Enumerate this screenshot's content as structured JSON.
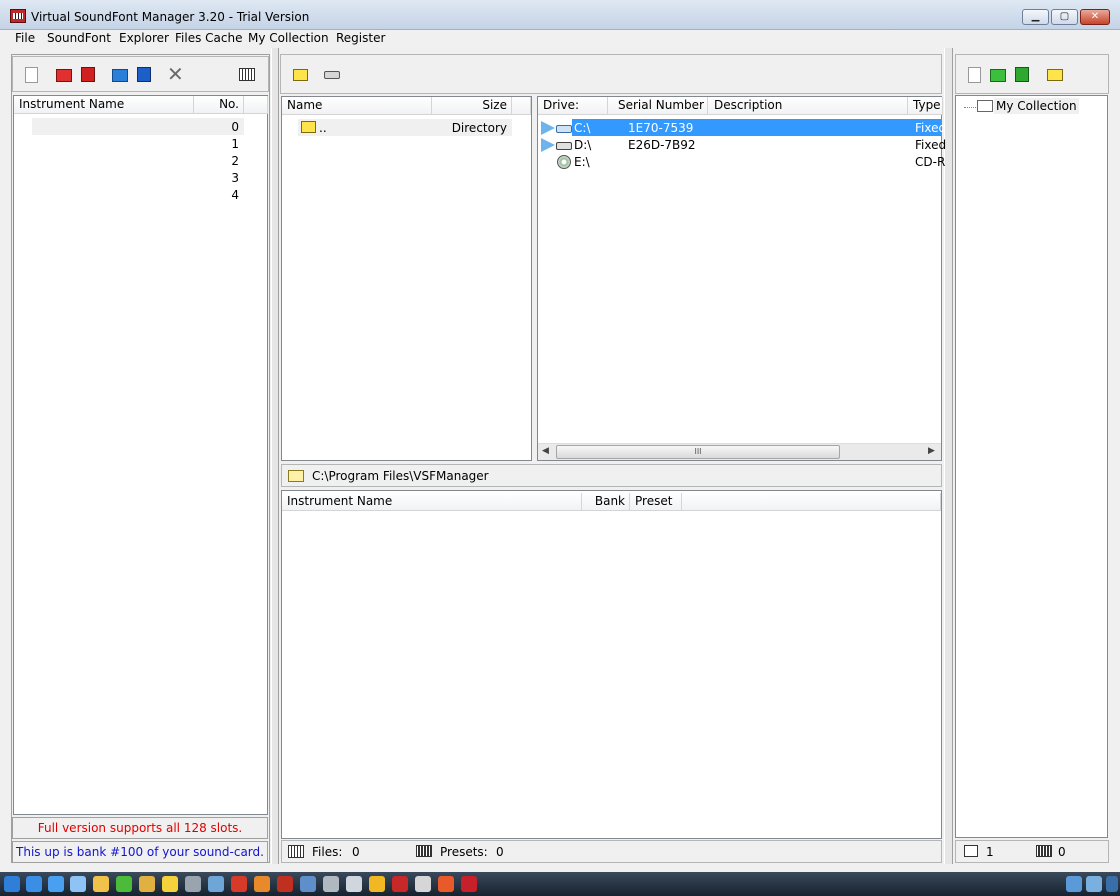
{
  "window": {
    "title": "Virtual SoundFont Manager 3.20 - Trial Version",
    "min_glyph": "▁",
    "max_glyph": "▢",
    "close_glyph": "✕"
  },
  "menu": [
    "File",
    "SoundFont",
    "Explorer",
    "Files Cache",
    "My Collection",
    "Register"
  ],
  "left": {
    "columns": [
      "Instrument Name",
      "No."
    ],
    "slots": [
      "0",
      "1",
      "2",
      "3",
      "4"
    ],
    "status_red": "Full version supports all 128 slots.",
    "status_blue": "This up is bank #100 of your sound-card."
  },
  "files": {
    "columns": [
      "Name",
      "Size"
    ],
    "rows": [
      {
        "name": "..",
        "size": "Directory"
      }
    ]
  },
  "drives": {
    "columns": [
      "Drive:",
      "Serial Number",
      "Description",
      "Type"
    ],
    "rows": [
      {
        "drive": "C:\\",
        "serial": "1E70-7539",
        "description": "",
        "type": "Fixed",
        "selected": true
      },
      {
        "drive": "D:\\",
        "serial": "E26D-7B92",
        "description": "",
        "type": "Fixed",
        "selected": false
      },
      {
        "drive": "E:\\",
        "serial": "",
        "description": "",
        "type": "CD-R",
        "selected": false
      }
    ],
    "scroll_grip": "III"
  },
  "path": {
    "current": "C:\\Program Files\\VSFManager"
  },
  "instruments": {
    "columns": [
      "Instrument Name",
      "Bank",
      "Preset"
    ]
  },
  "status": {
    "files_label": "Files:",
    "files_count": "0",
    "presets_label": "Presets:",
    "presets_count": "0"
  },
  "collection": {
    "root": "My Collection",
    "count_a": "1",
    "count_b": "0"
  },
  "colors": {
    "selection": "#3399ff",
    "red_text": "#e00000",
    "blue_text": "#1414d0"
  }
}
